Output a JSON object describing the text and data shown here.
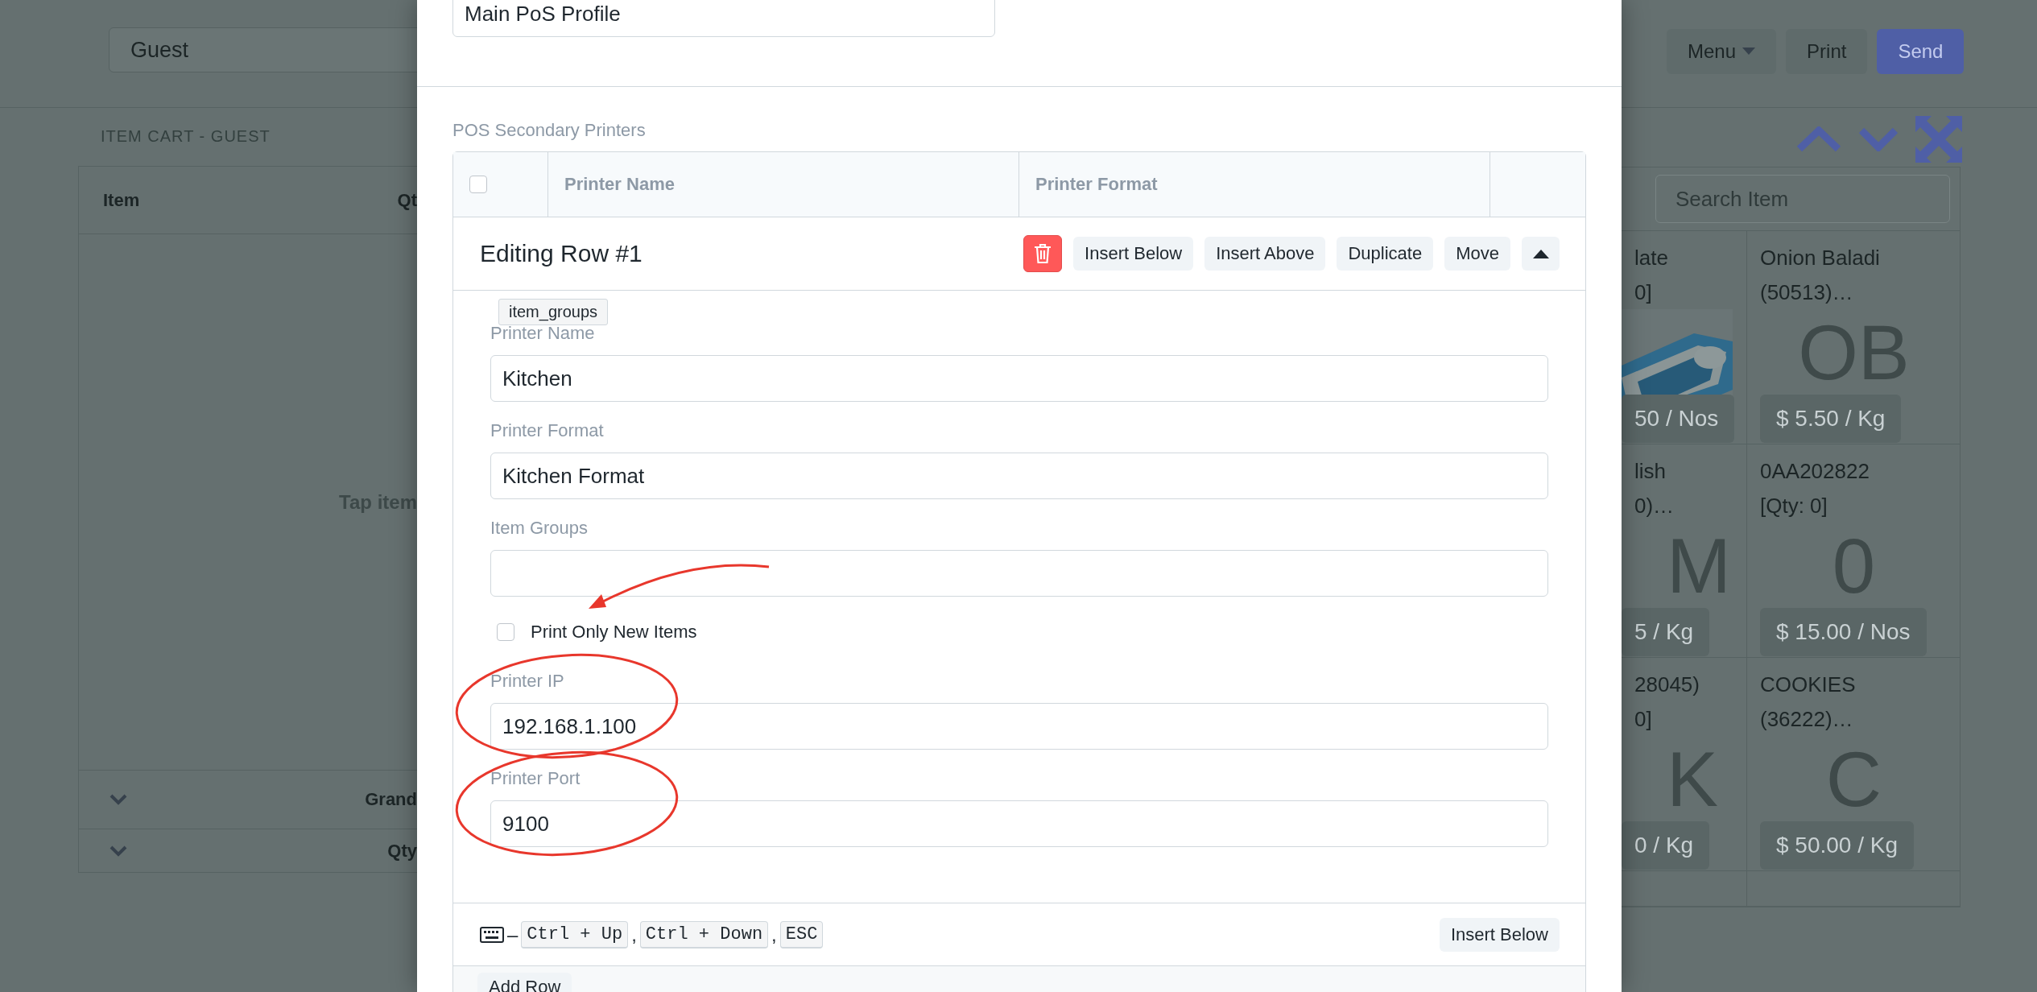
{
  "background": {
    "customer_field": {
      "value": "Guest"
    },
    "cart": {
      "title": "ITEM CART - GUEST",
      "columns": [
        "Item",
        "Qt"
      ],
      "empty_message": "Tap item",
      "summary_rows": [
        {
          "label": "Grand"
        },
        {
          "label": "Qty"
        }
      ]
    },
    "toolbar": [
      {
        "label": "Menu",
        "kind": "dropdown"
      },
      {
        "label": "Print",
        "kind": "default"
      },
      {
        "label": "Send",
        "kind": "primary"
      }
    ],
    "search": {
      "placeholder": "Search Item"
    },
    "items": [
      {
        "line_1": "late",
        "line_2": "0]",
        "kind": "picture",
        "price": "50 / Nos"
      },
      {
        "line_1": "Onion Baladi",
        "line_2": "(50513)…",
        "kind": "letter",
        "letter": "OB",
        "price": "$ 5.50 / Kg"
      },
      {
        "line_1": "lish",
        "line_2": "0)…",
        "kind": "letter",
        "letter": "M",
        "price": "5 / Kg"
      },
      {
        "line_1": "0AA202822",
        "line_2": "[Qty: 0]",
        "kind": "letter",
        "letter": "0",
        "price": "$ 15.00 / Nos"
      },
      {
        "line_1": "28045)",
        "line_2": "0]",
        "kind": "letter",
        "letter": "K",
        "price": "0 / Kg"
      },
      {
        "line_1": "COOKIES",
        "line_2": "(36222)…",
        "kind": "letter",
        "letter": "C",
        "price": "$ 50.00 / Kg"
      }
    ]
  },
  "dialog": {
    "profile_field": {
      "value": "Main PoS Profile"
    },
    "section_label": "POS Secondary Printers",
    "grid": {
      "select_all": {
        "checked": false
      },
      "columns": [
        "Printer Name",
        "Printer Format"
      ],
      "editing_row": {
        "title": "Editing Row #1",
        "tooltip": "item_groups",
        "actions": [
          {
            "kind": "delete"
          },
          {
            "kind": "text",
            "label": "Insert Below"
          },
          {
            "kind": "text",
            "label": "Insert Above"
          },
          {
            "kind": "text",
            "label": "Duplicate"
          },
          {
            "kind": "text",
            "label": "Move"
          },
          {
            "kind": "collapse"
          }
        ],
        "fields": [
          {
            "kind": "text",
            "label": "Printer Name",
            "value": "Kitchen",
            "circled": false
          },
          {
            "kind": "text",
            "label": "Printer Format",
            "value": "Kitchen Format",
            "circled": false
          },
          {
            "kind": "text",
            "label": "Item Groups",
            "circled": false
          },
          {
            "kind": "checkbox",
            "label": "Print Only New Items",
            "checked": false,
            "arrow": true
          },
          {
            "kind": "text",
            "label": "Printer IP",
            "value": "192.168.1.100",
            "circled": true
          },
          {
            "kind": "text",
            "label": "Printer Port",
            "value": "9100",
            "circled": true
          }
        ]
      },
      "shortcuts": {
        "dash": "–",
        "keys": [
          "Ctrl + Up",
          "Ctrl + Down",
          "ESC"
        ],
        "separator": ","
      },
      "insert_button": "Insert Below"
    },
    "add_row_button": "Add Row"
  }
}
